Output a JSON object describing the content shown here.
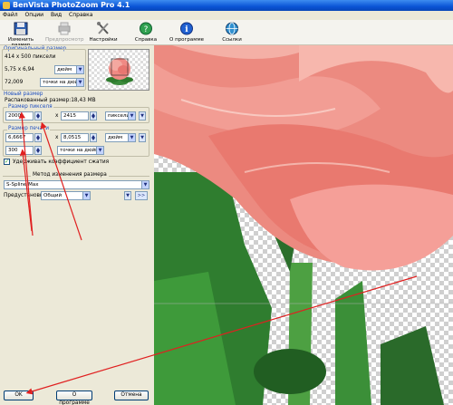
{
  "window": {
    "title": "BenVista PhotoZoom Pro 4.1"
  },
  "menu": [
    "Файл",
    "Опции",
    "Вид",
    "Справка"
  ],
  "toolbar": {
    "resize": "Изменить размер",
    "preview": "Предпросмотр",
    "settings": "Настройки",
    "help": "Справка",
    "about": "О программе",
    "links": "Ссылки"
  },
  "original_size": {
    "group_title": "Оригинальный размер",
    "pixels_text": "414 x 500 пиксели",
    "inches_text": "5,75 x 6,94",
    "inches_unit": "дюйм",
    "resolution": "72,009",
    "resolution_unit": "точки на дюйм"
  },
  "new_size": {
    "group_title": "Новый размер",
    "memory": "Распакованный размер:18,43 MB",
    "pixel_group": "Размер пикселя",
    "width_px": "2000",
    "height_px": "2415",
    "px_unit": "пиксели",
    "print_group": "Размер печати",
    "width_in": "6,6667",
    "height_in": "8,0515",
    "in_unit": "дюйм",
    "dpi": "300",
    "dpi_unit": "точки на дюйм",
    "keep_ratio": "Удерживать коэффициент сжатия",
    "times": "x"
  },
  "method": {
    "group_title": "Метод изменения размера",
    "value": "S-Spline Max",
    "preset_label": "Предустановка:",
    "preset_value": "Общий",
    "more": ">>"
  },
  "buttons": {
    "ok": "OK",
    "about": "О программе",
    "cancel": "Отмена"
  },
  "colors": {
    "title_blue": "#0a54d6",
    "arrow_red": "#e02020",
    "group_blue": "#2050c0"
  }
}
